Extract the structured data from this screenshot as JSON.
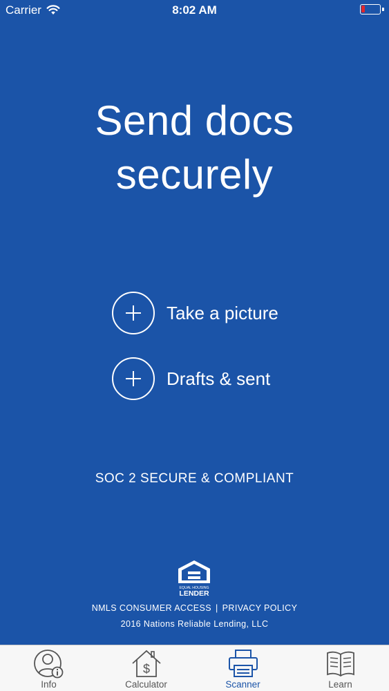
{
  "status_bar": {
    "carrier": "Carrier",
    "time": "8:02 AM",
    "battery_color": "#e0262a"
  },
  "colors": {
    "background": "#1b54a8",
    "text": "#ffffff",
    "tab_bar": "#f7f7f7",
    "tab_active": "#1b54a8",
    "tab_inactive": "#555555"
  },
  "headline": {
    "line1": "Send docs",
    "line2": "securely"
  },
  "actions": [
    {
      "label": "Take a picture",
      "icon": "plus-circle-icon"
    },
    {
      "label": "Drafts & sent",
      "icon": "plus-circle-icon"
    }
  ],
  "compliance": "SOC 2 SECURE & COMPLIANT",
  "footer": {
    "logo": {
      "line1": "EQUAL HOUSING",
      "line2": "LENDER"
    },
    "link_nmls": "NMLS CONSUMER ACCESS",
    "separator": "|",
    "link_privacy": "PRIVACY POLICY",
    "copyright": "2016 Nations Reliable Lending, LLC"
  },
  "tabs": [
    {
      "label": "Info",
      "icon": "user-info-icon",
      "active": false
    },
    {
      "label": "Calculator",
      "icon": "house-dollar-icon",
      "active": false
    },
    {
      "label": "Scanner",
      "icon": "scanner-icon",
      "active": true
    },
    {
      "label": "Learn",
      "icon": "book-icon",
      "active": false
    }
  ]
}
